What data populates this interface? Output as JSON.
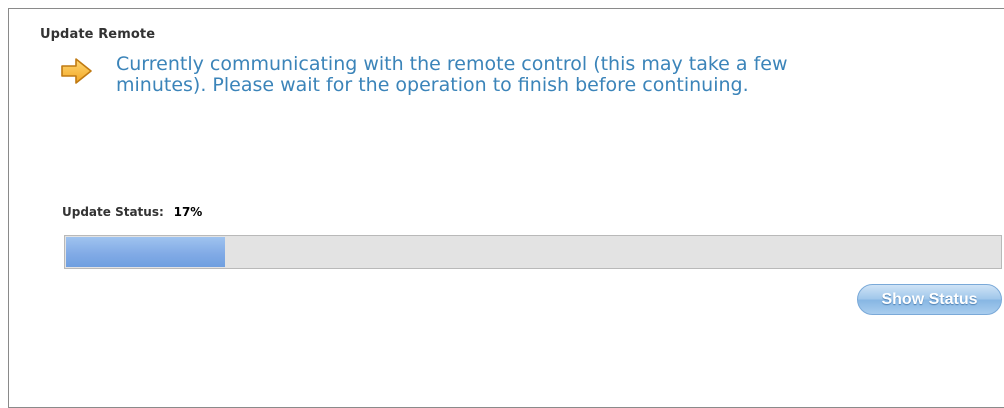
{
  "section": {
    "title": "Update Remote"
  },
  "message": {
    "icon": "arrow-right-icon",
    "text": "Currently communicating with the remote control (this may take a few minutes). Please wait for the operation to finish before continuing."
  },
  "status": {
    "label": "Update Status:",
    "value": "17%",
    "progress_percent": 17,
    "progress_color": "#82abe6",
    "track_color": "#e3e3e3"
  },
  "actions": {
    "show_status_label": "Show Status"
  },
  "colors": {
    "message_text": "#3b84b9",
    "icon_fill": "#f5b52f"
  }
}
